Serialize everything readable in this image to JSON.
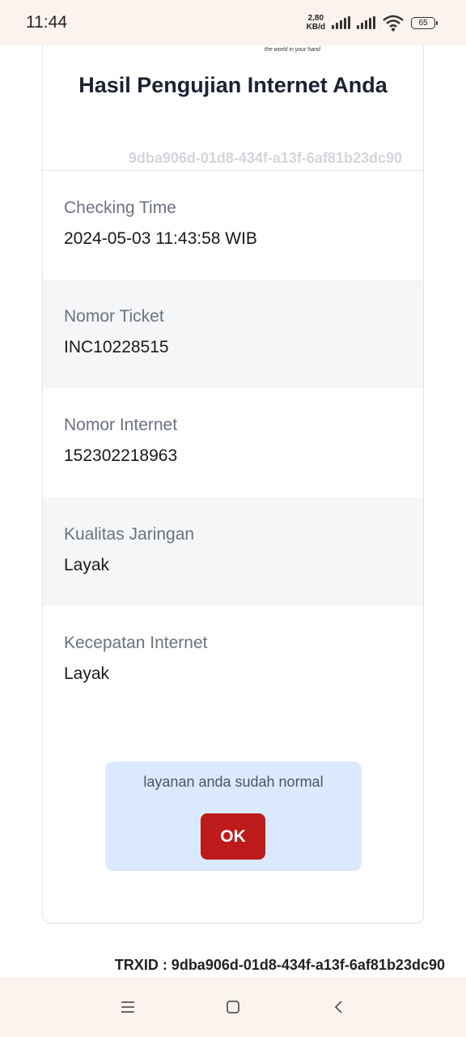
{
  "status_bar": {
    "time": "11:44",
    "net_speed_value": "2,80",
    "net_speed_unit": "KB/d",
    "battery": "65"
  },
  "header": {
    "tagline": "the world in your hand",
    "title": "Hasil Pengujian Internet Anda",
    "transaction_id": "9dba906d-01d8-434f-a13f-6af81b23dc90"
  },
  "details": [
    {
      "label": "Checking Time",
      "value": "2024-05-03 11:43:58 WIB"
    },
    {
      "label": "Nomor Ticket",
      "value": "INC10228515"
    },
    {
      "label": "Nomor Internet",
      "value": "152302218963"
    },
    {
      "label": "Kualitas Jaringan",
      "value": "Layak"
    },
    {
      "label": "Kecepatan Internet",
      "value": "Layak"
    }
  ],
  "alert": {
    "message": "layanan anda sudah normal",
    "ok_label": "OK"
  },
  "footer": {
    "trxid": "TRXID : 9dba906d-01d8-434f-a13f-6af81b23dc90"
  },
  "nav_icons": [
    "menu-icon",
    "home-icon",
    "back-icon"
  ],
  "colors": {
    "ok_button": "#bd1b1b",
    "alert_background": "#dbe9fc",
    "system_bar": "#fdf3ee"
  }
}
